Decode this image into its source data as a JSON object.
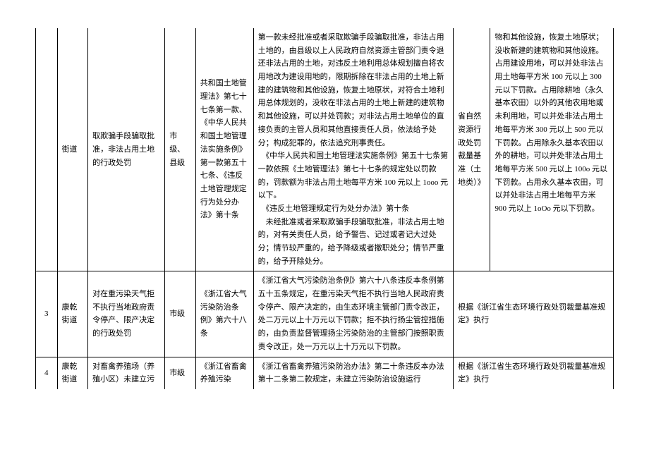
{
  "row2_cont": {
    "dept": "街道",
    "matter": "取欺骗手段骗取批准，非法占用土地的行政处罚",
    "level": "市级、县级",
    "law": "共和国土地管理法》第七十七条第一款、《中华人民共和国土地管理法实施条例》第一款第五十七条、《违反土地管理规定行为处分办法》第十条",
    "detail": "第一款未经批准或者采取欺骗手段骗取批准，非法占用土地的，由县级以上人民政府自然资源主管部门责令退还非法占用的土地，对违反土地利用总体规划擅自将农用地改为建设用地的，限期拆除在非法占用的土地上新建的建筑物和其他设施，恢复土地原状，对符合土地利用总体规划的，没收在非法占用的土地上新建的建筑物和其他设施，可以并处罚款；对非法占用土地单位的直接负责的主管人员和其他直接责任人员，依法给予处分；构成犯罪的，依法追究刑事责任。\n　《中华人民共和国土地管理法实施条例》第五十七条第一款依照《土地管理法》第七十七条的规定处以罚款的，罚款额为非法占用土地每平方米 100 元以上 1ooo 元以下。\n　《违反土地管理规定行为处分办法》第十条\n　未经批准或者采取欺骗手段骗取批准，非法占用土地的，对有关责任人员，给予警告、记过或者记大过处分；情节较严重的，给予降级或者撤职处分；情节严重的，给予开除处分。",
    "org": "省自然资源行政处罚裁量基准（土地类）》",
    "std": "物和其他设施，恢复土地原状；没收新建的建筑物和其他设施。占用建设用地，可以并处非法占用土地每平方米 100 元以上 300 元以下罚款。占用除耕地（永久基本农田）以外的其他农用地或未利用地，可以并处非法占用土地每平方米 300 元以上 500 元以下罚款。占用除永久基本农田以外的耕地，可以并处非法占用土地每平方米 500 元以上 100o 元以下罚款。占用永久基本农田，可以并处非法占用土地每平方米 900 元以上 1oOo 元以下罚款。"
  },
  "row3": {
    "num": "3",
    "dept": "康乾街道",
    "matter": "对在重污染天气拒不执行当地政府责令停产、限产决定的行政处罚",
    "level": "市级",
    "law": "《浙江省大气污染防治条例》第六十八条",
    "detail": "《浙江省大气污染防治条例》第六十八条违反本条例第五十五条规定，在重污染天气拒不执行当地人民政府责令停产、限产决定的，由生态环境主管部门责令改正，处二万元以上十万元以下罚款；拒不执行扬尘管控措施的，由负责监督管理扬尘污染防治的主管部门按照职责责令改正，处一万元以上十万元以下罚款。",
    "std": "根据《浙江省生态环境行政处罚裁量基准规定》执行"
  },
  "row4": {
    "num": "4",
    "dept": "康乾街道",
    "matter": "对畜禽养殖场（养殖小区）未建立污",
    "level": "市级",
    "law": "《浙江省畜禽养殖污染",
    "detail": "《浙江省畜禽养殖污染防治办法》第二十条违反本办法第十二条第二款规定，未建立污染防治设施运行",
    "std": "根据《浙江省生态环境行政处罚裁量基准规定》执行"
  }
}
